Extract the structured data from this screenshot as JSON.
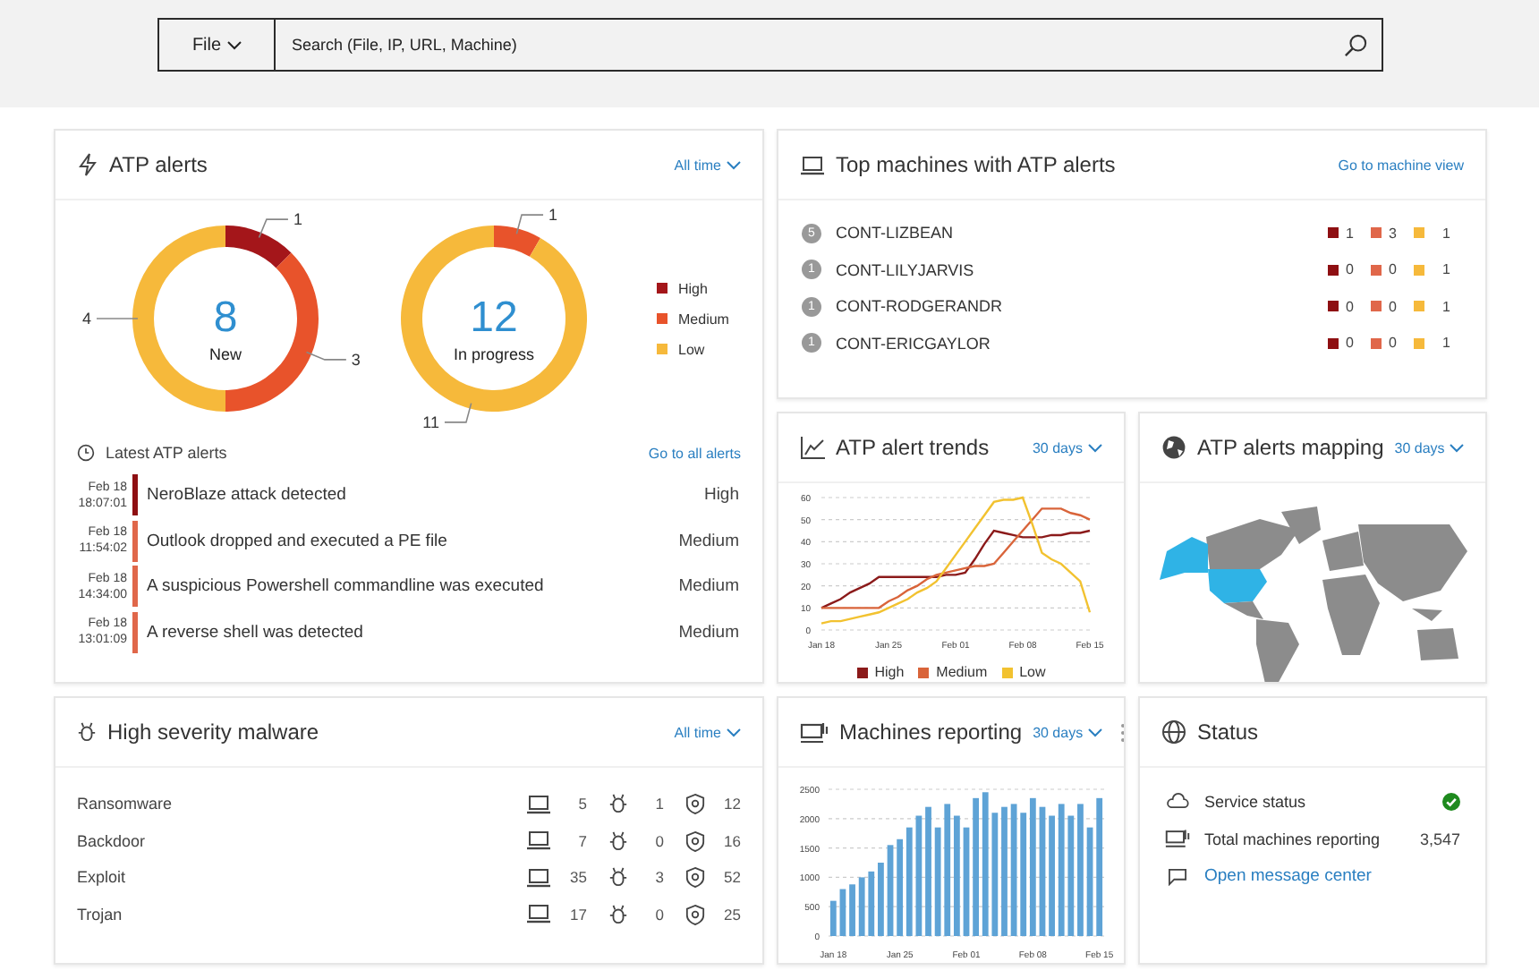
{
  "search_bar": {
    "scope": "File",
    "placeholder": "Search (File, IP, URL, Machine)"
  },
  "atp_alerts": {
    "title": "ATP alerts",
    "range": "All time",
    "donuts": [
      {
        "total": "8",
        "chart_data": {
          "type": "donut",
          "series": [
            {
              "name": "New",
              "values": [
                1,
                3,
                4
              ]
            }
          ],
          "data_labels": true
        }
      },
      {
        "total": "12",
        "chart_data": {
          "type": "donut",
          "series": [
            {
              "name": "In progress",
              "values": [
                0,
                1,
                11
              ]
            }
          ],
          "data_labels": true
        }
      }
    ],
    "legend": [
      {
        "label": "High",
        "color": "#a4161a"
      },
      {
        "label": "Medium",
        "color": "#e8532b"
      },
      {
        "label": "Low",
        "color": "#f6b93b"
      }
    ],
    "latest": {
      "title": "Latest ATP alerts",
      "link": "Go to all alerts",
      "rows": [
        {
          "date": "Feb 18",
          "time": "18:07:01",
          "title": "NeroBlaze attack detected",
          "severity": "High",
          "color": "#8e0f12"
        },
        {
          "date": "Feb 18",
          "time": "11:54:02",
          "title": "Outlook dropped and executed a PE file",
          "severity": "Medium",
          "color": "#e0674a"
        },
        {
          "date": "Feb 18",
          "time": "14:34:00",
          "title": "A suspicious Powershell commandline was executed",
          "severity": "Medium",
          "color": "#e0674a"
        },
        {
          "date": "Feb 18",
          "time": "13:01:09",
          "title": "A reverse shell was detected",
          "severity": "Medium",
          "color": "#e0674a"
        }
      ]
    }
  },
  "top_machines": {
    "title": "Top machines with ATP alerts",
    "link": "Go to machine view",
    "rows": [
      {
        "badge": "5",
        "name": "CONT-LIZBEAN",
        "high": "1",
        "medium": "3",
        "low": "1"
      },
      {
        "badge": "1",
        "name": "CONT-LILYJARVIS",
        "high": "0",
        "medium": "0",
        "low": "1"
      },
      {
        "badge": "1",
        "name": "CONT-RODGERANDR",
        "high": "0",
        "medium": "0",
        "low": "1"
      },
      {
        "badge": "1",
        "name": "CONT-ERICGAYLOR",
        "high": "0",
        "medium": "0",
        "low": "1"
      }
    ]
  },
  "alert_trends": {
    "title": "ATP alert trends",
    "range": "30 days",
    "chart_data": {
      "type": "line",
      "categories": [
        "Jan 18",
        null,
        null,
        null,
        null,
        null,
        null,
        "Jan 25",
        null,
        null,
        null,
        null,
        null,
        null,
        "Feb 01",
        null,
        null,
        null,
        null,
        null,
        null,
        "Feb 08",
        null,
        null,
        null,
        null,
        null,
        null,
        "Feb 15"
      ],
      "yticks": [
        0,
        10,
        20,
        30,
        40,
        50,
        60
      ],
      "ylim": [
        0,
        60
      ],
      "grid": true,
      "legend": "bottom",
      "series": [
        {
          "name": "High",
          "color": "#8b1a1a",
          "values": [
            10,
            12,
            14,
            17,
            19,
            21,
            24,
            24,
            24,
            24,
            24,
            24,
            24,
            25,
            25,
            26,
            32,
            39,
            45,
            44,
            43,
            42,
            42,
            42,
            43,
            43,
            44,
            44,
            45
          ]
        },
        {
          "name": "Medium",
          "color": "#d9643a",
          "values": [
            10,
            10,
            10,
            10,
            10,
            10,
            10,
            13,
            15,
            18,
            20,
            23,
            25,
            26,
            27,
            28,
            29,
            29,
            30,
            35,
            40,
            45,
            50,
            55,
            55,
            55,
            53,
            52,
            50
          ]
        },
        {
          "name": "Low",
          "color": "#f2c230",
          "values": [
            3,
            4,
            4,
            5,
            6,
            7,
            8,
            10,
            12,
            14,
            17,
            19,
            22,
            28,
            34,
            40,
            46,
            52,
            58,
            59,
            59,
            60,
            48,
            35,
            32,
            30,
            26,
            22,
            8
          ]
        }
      ]
    }
  },
  "alerts_mapping": {
    "title": "ATP alerts mapping",
    "range": "30 days"
  },
  "malware": {
    "title": "High severity malware",
    "range": "All time",
    "rows": [
      {
        "name": "Ransomware",
        "machines": "5",
        "files": "1",
        "detections": "12"
      },
      {
        "name": "Backdoor",
        "machines": "7",
        "files": "0",
        "detections": "16"
      },
      {
        "name": "Exploit",
        "machines": "35",
        "files": "3",
        "detections": "52"
      },
      {
        "name": "Trojan",
        "machines": "17",
        "files": "0",
        "detections": "25"
      }
    ]
  },
  "machines_reporting": {
    "title": "Machines reporting",
    "range": "30 days",
    "chart_data": {
      "type": "bar",
      "categories": [
        "Jan 18",
        null,
        null,
        null,
        null,
        null,
        null,
        "Jan 25",
        null,
        null,
        null,
        null,
        null,
        null,
        "Feb 01",
        null,
        null,
        null,
        null,
        null,
        null,
        "Feb 08",
        null,
        null,
        null,
        null,
        null,
        null,
        "Feb 15"
      ],
      "yticks": [
        0,
        500,
        1000,
        1500,
        2000,
        2500
      ],
      "ylim": [
        0,
        2500
      ],
      "grid": true,
      "values": [
        600,
        800,
        880,
        1000,
        1100,
        1250,
        1550,
        1650,
        1850,
        2050,
        2200,
        1850,
        2250,
        2050,
        1850,
        2350,
        2450,
        2100,
        2200,
        2250,
        2100,
        2350,
        2200,
        2050,
        2250,
        2050,
        2250,
        1850,
        2350
      ]
    }
  },
  "status": {
    "title": "Status",
    "items": [
      {
        "kind": "service",
        "label": "Service status",
        "ok": true
      },
      {
        "kind": "count",
        "label": "Total machines reporting",
        "value": "3,547"
      },
      {
        "kind": "link",
        "label": "Open message center"
      }
    ]
  }
}
